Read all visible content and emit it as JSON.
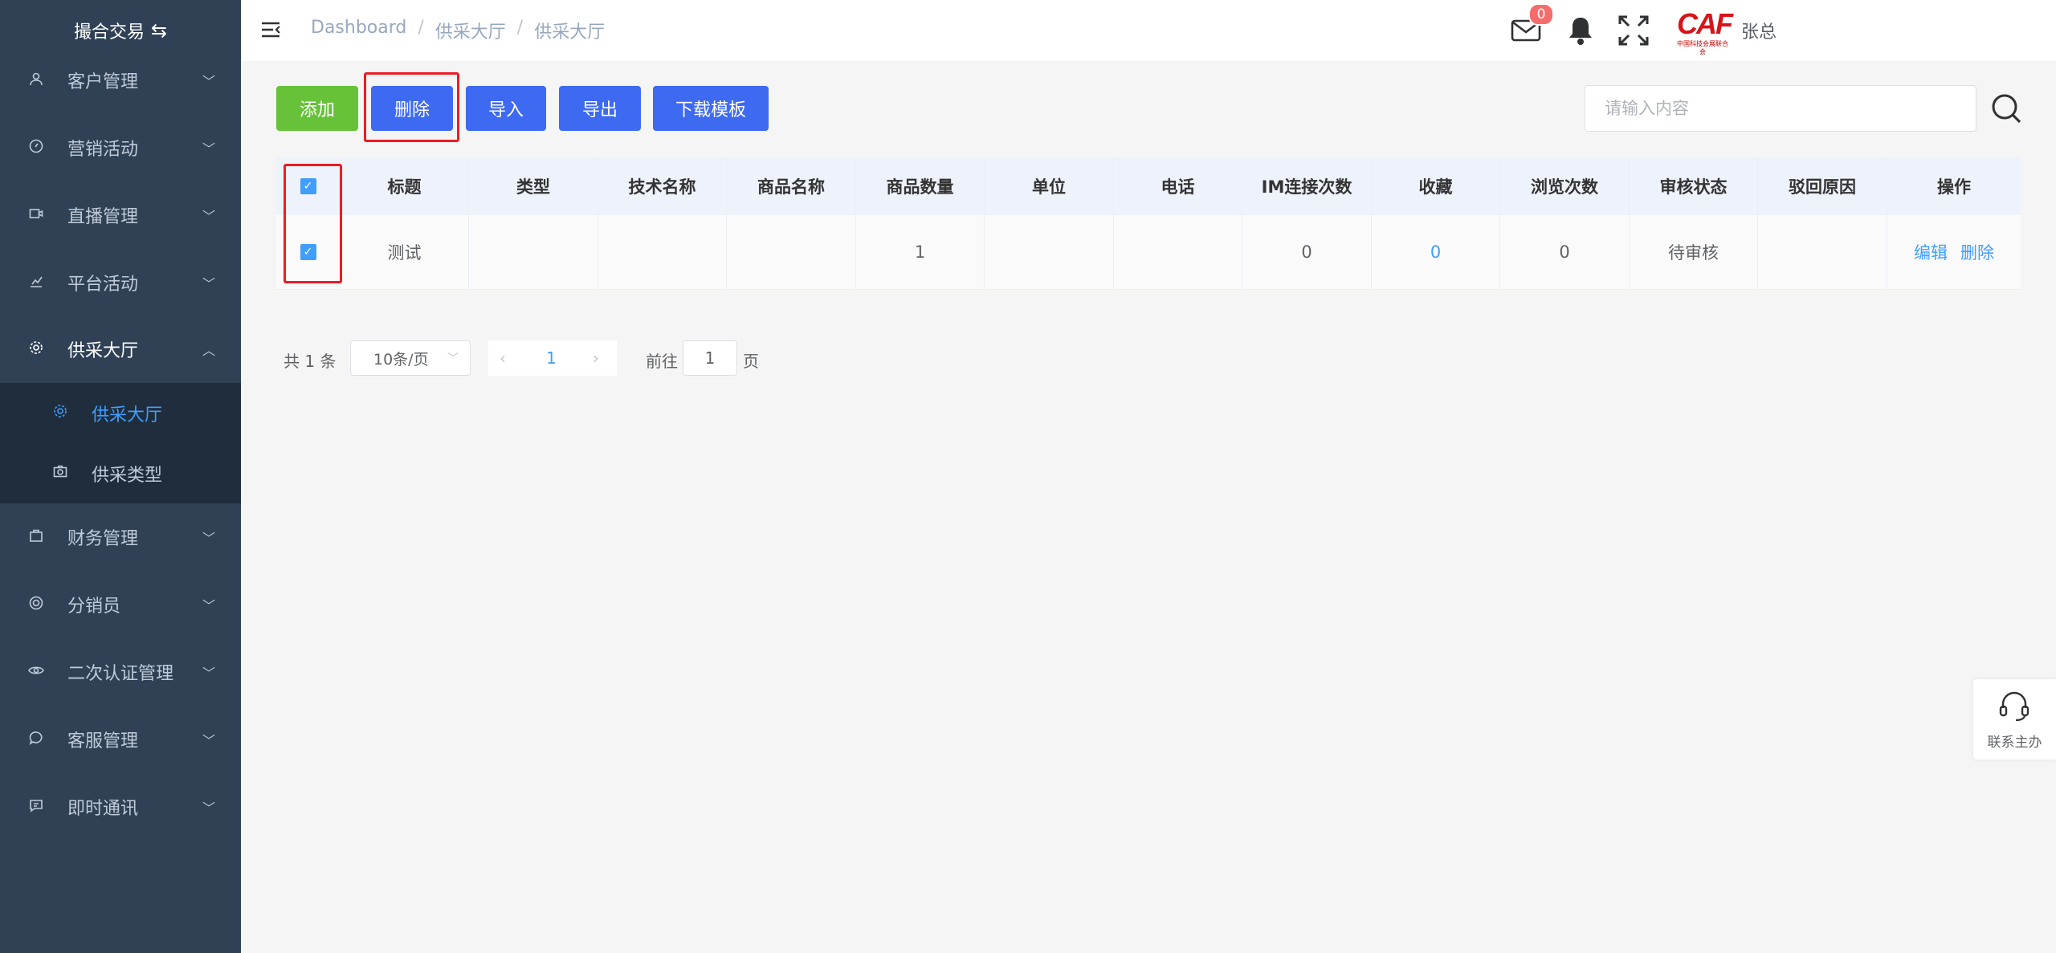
{
  "sidebar": {
    "brand": "撮合交易",
    "items": [
      {
        "label": "客户管理",
        "icon": "user-icon"
      },
      {
        "label": "营销活动",
        "icon": "compass-icon"
      },
      {
        "label": "直播管理",
        "icon": "video-icon"
      },
      {
        "label": "平台活动",
        "icon": "chart-icon"
      },
      {
        "label": "供采大厅",
        "icon": "gear-icon"
      },
      {
        "label": "财务管理",
        "icon": "briefcase-icon"
      },
      {
        "label": "分销员",
        "icon": "globe-icon"
      },
      {
        "label": "二次认证管理",
        "icon": "eye-icon"
      },
      {
        "label": "客服管理",
        "icon": "chat-icon"
      },
      {
        "label": "即时通讯",
        "icon": "message-icon"
      }
    ],
    "submenu": [
      {
        "label": "供采大厅",
        "icon": "gear-icon",
        "active": true
      },
      {
        "label": "供采类型",
        "icon": "camera-icon",
        "active": false
      }
    ]
  },
  "header": {
    "breadcrumb": [
      "Dashboard",
      "供采大厅",
      "供采大厅"
    ],
    "mail_badge": "0",
    "logo_text": "CAF",
    "logo_subtext": "中国科技会展联合会",
    "username": "张总"
  },
  "toolbar": {
    "add": "添加",
    "delete": "删除",
    "import": "导入",
    "export": "导出",
    "download_template": "下载模板",
    "search_placeholder": "请输入内容"
  },
  "table": {
    "columns": [
      "标题",
      "类型",
      "技术名称",
      "商品名称",
      "商品数量",
      "单位",
      "电话",
      "IM连接次数",
      "收藏",
      "浏览次数",
      "审核状态",
      "驳回原因",
      "操作"
    ],
    "rows": [
      {
        "title": "测试",
        "type": "",
        "tech_name": "",
        "product_name": "",
        "quantity": "1",
        "unit": "",
        "phone": "",
        "im_count": "0",
        "favorites": "0",
        "views": "0",
        "status": "待审核",
        "reject_reason": "",
        "edit": "编辑",
        "delete": "删除"
      }
    ]
  },
  "pagination": {
    "total": "共 1 条",
    "page_size": "10条/页",
    "current_page": "1",
    "goto_label": "前往",
    "goto_value": "1",
    "page_suffix": "页"
  },
  "contact": {
    "label": "联系主办"
  },
  "colors": {
    "sidebar_bg": "#304156",
    "primary": "#409eff",
    "button_blue": "#3e6af2",
    "success": "#67c23a",
    "danger": "#f56c6c",
    "highlight_box": "#ec1c24"
  }
}
